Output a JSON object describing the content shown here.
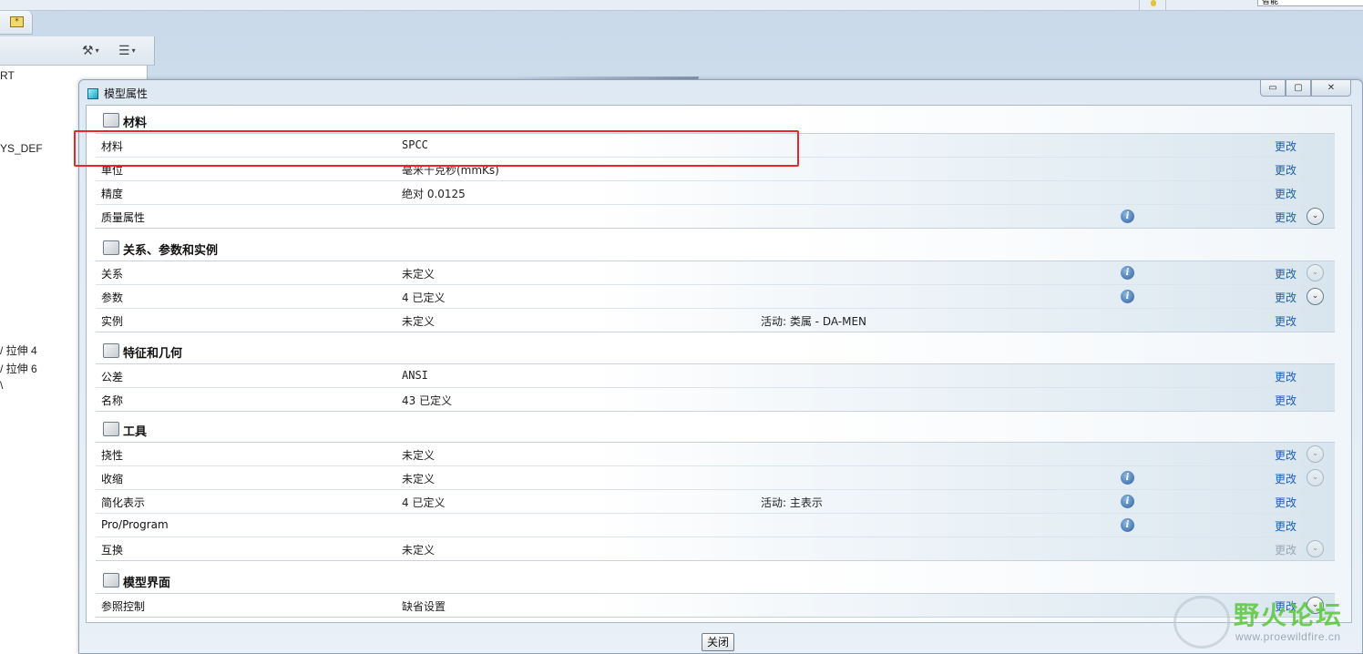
{
  "top": {
    "tab_icon": "*",
    "search_value": "智能"
  },
  "tree": {
    "toolbar": {
      "settings_icon": "tools-icon",
      "show_icon": "list-icon",
      "dropdown": "▾"
    },
    "items": [
      "RT",
      "YS_DEF",
      "/ 拉伸 4",
      "/ 拉伸 6",
      "\\"
    ]
  },
  "dialog": {
    "title": "模型属性",
    "window_buttons": {
      "minimize": "▭",
      "maximize": "▢",
      "close": "✕"
    },
    "change_label": "更改",
    "info_glyph": "i",
    "expand_glyph": "⌄",
    "sections": [
      {
        "title": "材料",
        "icon": "material-icon",
        "rows": [
          {
            "name": "材料",
            "value": "SPCC",
            "active": "",
            "info": false,
            "change": "更改",
            "disabled": false,
            "expand": ""
          },
          {
            "name": "单位",
            "value": "毫米千克秒(mmKs)",
            "active": "",
            "info": false,
            "change": "更改",
            "disabled": false,
            "expand": ""
          },
          {
            "name": "精度",
            "value": "绝对 0.0125",
            "active": "",
            "info": false,
            "change": "更改",
            "disabled": false,
            "expand": ""
          },
          {
            "name": "质量属性",
            "value": "",
            "active": "",
            "info": true,
            "change": "更改",
            "disabled": false,
            "expand": "dark"
          }
        ]
      },
      {
        "title": "关系、参数和实例",
        "icon": "relations-icon",
        "rows": [
          {
            "name": "关系",
            "value": "未定义",
            "active": "",
            "info": true,
            "change": "更改",
            "disabled": false,
            "expand": "faded"
          },
          {
            "name": "参数",
            "value": "4 已定义",
            "active": "",
            "info": true,
            "change": "更改",
            "disabled": false,
            "expand": "dark"
          },
          {
            "name": "实例",
            "value": "未定义",
            "active": "活动: 类属 - DA-MEN",
            "info": false,
            "change": "更改",
            "disabled": false,
            "expand": ""
          }
        ]
      },
      {
        "title": "特征和几何",
        "icon": "feature-geometry-icon",
        "rows": [
          {
            "name": "公差",
            "value": "ANSI",
            "active": "",
            "info": false,
            "change": "更改",
            "disabled": false,
            "expand": ""
          },
          {
            "name": "名称",
            "value": "43 已定义",
            "active": "",
            "info": false,
            "change": "更改",
            "disabled": false,
            "expand": ""
          }
        ]
      },
      {
        "title": "工具",
        "icon": "tools-icon",
        "rows": [
          {
            "name": "挠性",
            "value": "未定义",
            "active": "",
            "info": false,
            "change": "更改",
            "disabled": false,
            "expand": "faded"
          },
          {
            "name": "收缩",
            "value": "未定义",
            "active": "",
            "info": true,
            "change": "更改",
            "disabled": false,
            "expand": "faded"
          },
          {
            "name": "简化表示",
            "value": "4 已定义",
            "active": "活动: 主表示",
            "info": true,
            "change": "更改",
            "disabled": false,
            "expand": ""
          },
          {
            "name": "Pro/Program",
            "value": "",
            "active": "",
            "info": true,
            "change": "更改",
            "disabled": false,
            "expand": ""
          },
          {
            "name": "互换",
            "value": "未定义",
            "active": "",
            "info": false,
            "change": "更改",
            "disabled": true,
            "expand": "faded"
          }
        ]
      },
      {
        "title": "模型界面",
        "icon": "model-interface-icon",
        "rows": [
          {
            "name": "参照控制",
            "value": "缺省设置",
            "active": "",
            "info": false,
            "change": "更改",
            "disabled": false,
            "expand": "dark"
          }
        ]
      }
    ],
    "close_button": "关闭"
  },
  "watermark": {
    "text": "野火论坛",
    "url": "www.proewildfire.cn"
  },
  "colors": {
    "link": "#1c5fb0",
    "highlight": "#e8262b",
    "watermark_green": "#5ac83a"
  }
}
